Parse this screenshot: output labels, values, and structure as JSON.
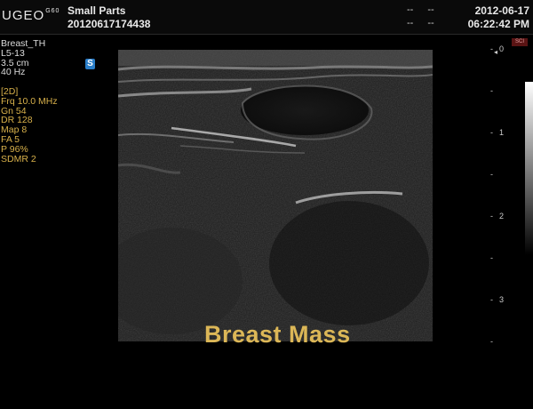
{
  "header": {
    "logo": "UGEO",
    "logo_suffix": "G60",
    "exam_type": "Small Parts",
    "patient_id": "20120617174438",
    "row1_dashes": [
      "--",
      "--"
    ],
    "row2_dashes": [
      "--",
      "--"
    ],
    "date": "2012-06-17",
    "time": "06:22:42 PM"
  },
  "probe_info": [
    "Breast_TH",
    "L5-13",
    "3.5 cm",
    "40 Hz"
  ],
  "params": [
    "[2D]",
    "Frq 10.0 MHz",
    "Gn  54",
    "DR  128",
    "Map 8",
    "FA  5",
    "P    96%",
    "SDMR 2"
  ],
  "s_badge": "S",
  "sci_badge": "SCI",
  "annotation": "Breast Mass",
  "depth_scale": [
    "0",
    "1",
    "2",
    "3"
  ],
  "colors": {
    "annotation": "#dcb757",
    "params": "#d7b04a",
    "badge": "#2a7ec9"
  }
}
